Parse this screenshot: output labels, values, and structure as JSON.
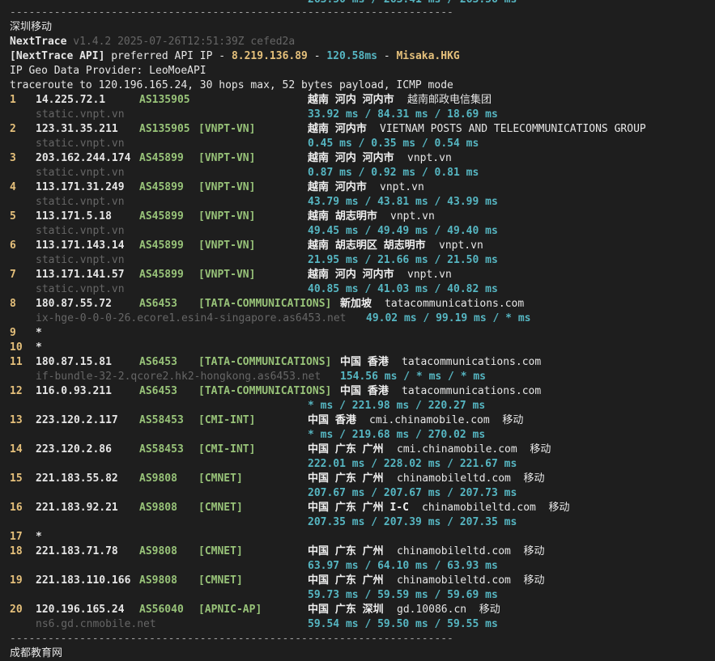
{
  "top_partial": "263.50 ms / 263.41 ms / 263.56 ms",
  "separator": "----------------------------------------------------------------------",
  "section_title": "深圳移动",
  "bottom_partial": "成都教育网",
  "header": {
    "tool_name": "NextTrace",
    "version": "v1.4.2 2025-07-26T12:51:39Z cefed2a",
    "api_prefix": "[NextTrace API]",
    "api_text": "preferred API IP -",
    "api_ip": "8.219.136.89",
    "api_dash1": "-",
    "api_latency": "120.58ms",
    "api_dash2": "-",
    "api_server": "Misaka.HKG",
    "geo_provider": "IP Geo Data Provider: LeoMoeAPI",
    "traceroute": "traceroute to 120.196.165.24, 30 hops max, 52 bytes payload, ICMP mode"
  },
  "hops": [
    {
      "num": "1",
      "ip": "14.225.72.1",
      "asn": "AS135905",
      "tag": "",
      "geo": "越南 河内 河内市",
      "org": "越南邮政电信集团",
      "rdns": "static.vnpt.vn",
      "rtt": "33.92 ms / 84.31 ms / 18.69 ms"
    },
    {
      "num": "2",
      "ip": "123.31.35.211",
      "asn": "AS135905",
      "tag": "[VNPT-VN]",
      "geo": "越南 河内市",
      "org": "VIETNAM POSTS AND TELECOMMUNICATIONS GROUP",
      "rdns": "static.vnpt.vn",
      "rtt": "0.45 ms / 0.35 ms / 0.54 ms"
    },
    {
      "num": "3",
      "ip": "203.162.244.174",
      "asn": "AS45899",
      "tag": "[VNPT-VN]",
      "geo": "越南 河内 河内市",
      "org": "vnpt.vn",
      "rdns": "static.vnpt.vn",
      "rtt": "0.87 ms / 0.92 ms / 0.81 ms"
    },
    {
      "num": "4",
      "ip": "113.171.31.249",
      "asn": "AS45899",
      "tag": "[VNPT-VN]",
      "geo": "越南 河内市",
      "org": "vnpt.vn",
      "rdns": "static.vnpt.vn",
      "rtt": "43.79 ms / 43.81 ms / 43.99 ms"
    },
    {
      "num": "5",
      "ip": "113.171.5.18",
      "asn": "AS45899",
      "tag": "[VNPT-VN]",
      "geo": "越南 胡志明市",
      "org": "vnpt.vn",
      "rdns": "static.vnpt.vn",
      "rtt": "49.45 ms / 49.49 ms / 49.40 ms"
    },
    {
      "num": "6",
      "ip": "113.171.143.14",
      "asn": "AS45899",
      "tag": "[VNPT-VN]",
      "geo": "越南 胡志明区 胡志明市",
      "org": "vnpt.vn",
      "rdns": "static.vnpt.vn",
      "rtt": "21.95 ms / 21.66 ms / 21.50 ms"
    },
    {
      "num": "7",
      "ip": "113.171.141.57",
      "asn": "AS45899",
      "tag": "[VNPT-VN]",
      "geo": "越南 河内 河内市",
      "org": "vnpt.vn",
      "rdns": "static.vnpt.vn",
      "rtt": "40.85 ms / 41.03 ms / 40.82 ms"
    },
    {
      "num": "8",
      "ip": "180.87.55.72",
      "asn": "AS6453",
      "tag": "[TATA-COMMUNICATIONS]",
      "geo": "新加坡",
      "org": "tatacommunications.com",
      "rdns": "ix-hge-0-0-0-26.ecore1.esin4-singapore.as6453.net",
      "rtt": "49.02 ms / 99.19 ms / * ms"
    },
    {
      "num": "9",
      "star": "*"
    },
    {
      "num": "10",
      "star": "*"
    },
    {
      "num": "11",
      "ip": "180.87.15.81",
      "asn": "AS6453",
      "tag": "[TATA-COMMUNICATIONS]",
      "geo": "中国 香港",
      "org": "tatacommunications.com",
      "rdns": "if-bundle-32-2.qcore2.hk2-hongkong.as6453.net",
      "rtt": "154.56 ms / * ms / * ms"
    },
    {
      "num": "12",
      "ip": "116.0.93.211",
      "asn": "AS6453",
      "tag": "[TATA-COMMUNICATIONS]",
      "geo": "中国 香港",
      "org": "tatacommunications.com",
      "rdns": "",
      "rtt": "* ms / 221.98 ms / 220.27 ms"
    },
    {
      "num": "13",
      "ip": "223.120.2.117",
      "asn": "AS58453",
      "tag": "[CMI-INT]",
      "geo": "中国 香港",
      "org": "cmi.chinamobile.com  移动",
      "rdns": "",
      "rtt": "* ms / 219.68 ms / 270.02 ms"
    },
    {
      "num": "14",
      "ip": "223.120.2.86",
      "asn": "AS58453",
      "tag": "[CMI-INT]",
      "geo": "中国 广东 广州",
      "org": "cmi.chinamobile.com  移动",
      "rdns": "",
      "rtt": "222.01 ms / 228.02 ms / 221.67 ms"
    },
    {
      "num": "15",
      "ip": "221.183.55.82",
      "asn": "AS9808",
      "tag": "[CMNET]",
      "geo": "中国 广东 广州",
      "org": "chinamobileltd.com  移动",
      "rdns": "",
      "rtt": "207.67 ms / 207.67 ms / 207.73 ms"
    },
    {
      "num": "16",
      "ip": "221.183.92.21",
      "asn": "AS9808",
      "tag": "[CMNET]",
      "geo": "中国 广东 广州 I-C",
      "org": "chinamobileltd.com  移动",
      "rdns": "",
      "rtt": "207.35 ms / 207.39 ms / 207.35 ms"
    },
    {
      "num": "17",
      "star": "*"
    },
    {
      "num": "18",
      "ip": "221.183.71.78",
      "asn": "AS9808",
      "tag": "[CMNET]",
      "geo": "中国 广东 广州",
      "org": "chinamobileltd.com  移动",
      "rdns": "",
      "rtt": "63.97 ms / 64.10 ms / 63.93 ms"
    },
    {
      "num": "19",
      "ip": "221.183.110.166",
      "asn": "AS9808",
      "tag": "[CMNET]",
      "geo": "中国 广东 广州",
      "org": "chinamobileltd.com  移动",
      "rdns": "",
      "rtt": "59.73 ms / 59.59 ms / 59.69 ms"
    },
    {
      "num": "20",
      "ip": "120.196.165.24",
      "asn": "AS56040",
      "tag": "[APNIC-AP]",
      "geo": "中国 广东 深圳",
      "org": "gd.10086.cn  移动",
      "rdns": "ns6.gd.cnmobile.net",
      "rtt": "59.54 ms / 59.50 ms / 59.55 ms"
    }
  ],
  "colors": {
    "background": "#1e1e1e",
    "hop_number": "#e5c07b",
    "asn": "#98c379",
    "rtt": "#56b6c2",
    "rdns": "#666666"
  }
}
